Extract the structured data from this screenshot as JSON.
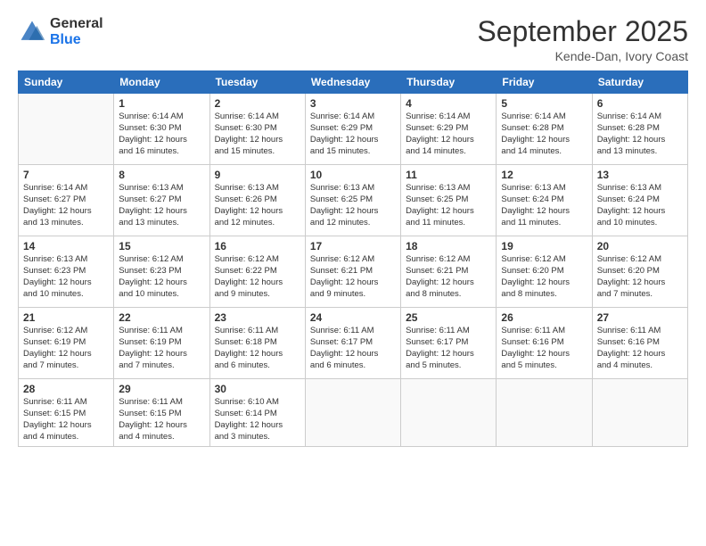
{
  "logo": {
    "general": "General",
    "blue": "Blue"
  },
  "header": {
    "month": "September 2025",
    "location": "Kende-Dan, Ivory Coast"
  },
  "days_of_week": [
    "Sunday",
    "Monday",
    "Tuesday",
    "Wednesday",
    "Thursday",
    "Friday",
    "Saturday"
  ],
  "weeks": [
    [
      {
        "day": "",
        "info": ""
      },
      {
        "day": "1",
        "info": "Sunrise: 6:14 AM\nSunset: 6:30 PM\nDaylight: 12 hours\nand 16 minutes."
      },
      {
        "day": "2",
        "info": "Sunrise: 6:14 AM\nSunset: 6:30 PM\nDaylight: 12 hours\nand 15 minutes."
      },
      {
        "day": "3",
        "info": "Sunrise: 6:14 AM\nSunset: 6:29 PM\nDaylight: 12 hours\nand 15 minutes."
      },
      {
        "day": "4",
        "info": "Sunrise: 6:14 AM\nSunset: 6:29 PM\nDaylight: 12 hours\nand 14 minutes."
      },
      {
        "day": "5",
        "info": "Sunrise: 6:14 AM\nSunset: 6:28 PM\nDaylight: 12 hours\nand 14 minutes."
      },
      {
        "day": "6",
        "info": "Sunrise: 6:14 AM\nSunset: 6:28 PM\nDaylight: 12 hours\nand 13 minutes."
      }
    ],
    [
      {
        "day": "7",
        "info": "Sunrise: 6:14 AM\nSunset: 6:27 PM\nDaylight: 12 hours\nand 13 minutes."
      },
      {
        "day": "8",
        "info": "Sunrise: 6:13 AM\nSunset: 6:27 PM\nDaylight: 12 hours\nand 13 minutes."
      },
      {
        "day": "9",
        "info": "Sunrise: 6:13 AM\nSunset: 6:26 PM\nDaylight: 12 hours\nand 12 minutes."
      },
      {
        "day": "10",
        "info": "Sunrise: 6:13 AM\nSunset: 6:25 PM\nDaylight: 12 hours\nand 12 minutes."
      },
      {
        "day": "11",
        "info": "Sunrise: 6:13 AM\nSunset: 6:25 PM\nDaylight: 12 hours\nand 11 minutes."
      },
      {
        "day": "12",
        "info": "Sunrise: 6:13 AM\nSunset: 6:24 PM\nDaylight: 12 hours\nand 11 minutes."
      },
      {
        "day": "13",
        "info": "Sunrise: 6:13 AM\nSunset: 6:24 PM\nDaylight: 12 hours\nand 10 minutes."
      }
    ],
    [
      {
        "day": "14",
        "info": "Sunrise: 6:13 AM\nSunset: 6:23 PM\nDaylight: 12 hours\nand 10 minutes."
      },
      {
        "day": "15",
        "info": "Sunrise: 6:12 AM\nSunset: 6:23 PM\nDaylight: 12 hours\nand 10 minutes."
      },
      {
        "day": "16",
        "info": "Sunrise: 6:12 AM\nSunset: 6:22 PM\nDaylight: 12 hours\nand 9 minutes."
      },
      {
        "day": "17",
        "info": "Sunrise: 6:12 AM\nSunset: 6:21 PM\nDaylight: 12 hours\nand 9 minutes."
      },
      {
        "day": "18",
        "info": "Sunrise: 6:12 AM\nSunset: 6:21 PM\nDaylight: 12 hours\nand 8 minutes."
      },
      {
        "day": "19",
        "info": "Sunrise: 6:12 AM\nSunset: 6:20 PM\nDaylight: 12 hours\nand 8 minutes."
      },
      {
        "day": "20",
        "info": "Sunrise: 6:12 AM\nSunset: 6:20 PM\nDaylight: 12 hours\nand 7 minutes."
      }
    ],
    [
      {
        "day": "21",
        "info": "Sunrise: 6:12 AM\nSunset: 6:19 PM\nDaylight: 12 hours\nand 7 minutes."
      },
      {
        "day": "22",
        "info": "Sunrise: 6:11 AM\nSunset: 6:19 PM\nDaylight: 12 hours\nand 7 minutes."
      },
      {
        "day": "23",
        "info": "Sunrise: 6:11 AM\nSunset: 6:18 PM\nDaylight: 12 hours\nand 6 minutes."
      },
      {
        "day": "24",
        "info": "Sunrise: 6:11 AM\nSunset: 6:17 PM\nDaylight: 12 hours\nand 6 minutes."
      },
      {
        "day": "25",
        "info": "Sunrise: 6:11 AM\nSunset: 6:17 PM\nDaylight: 12 hours\nand 5 minutes."
      },
      {
        "day": "26",
        "info": "Sunrise: 6:11 AM\nSunset: 6:16 PM\nDaylight: 12 hours\nand 5 minutes."
      },
      {
        "day": "27",
        "info": "Sunrise: 6:11 AM\nSunset: 6:16 PM\nDaylight: 12 hours\nand 4 minutes."
      }
    ],
    [
      {
        "day": "28",
        "info": "Sunrise: 6:11 AM\nSunset: 6:15 PM\nDaylight: 12 hours\nand 4 minutes."
      },
      {
        "day": "29",
        "info": "Sunrise: 6:11 AM\nSunset: 6:15 PM\nDaylight: 12 hours\nand 4 minutes."
      },
      {
        "day": "30",
        "info": "Sunrise: 6:10 AM\nSunset: 6:14 PM\nDaylight: 12 hours\nand 3 minutes."
      },
      {
        "day": "",
        "info": ""
      },
      {
        "day": "",
        "info": ""
      },
      {
        "day": "",
        "info": ""
      },
      {
        "day": "",
        "info": ""
      }
    ]
  ]
}
